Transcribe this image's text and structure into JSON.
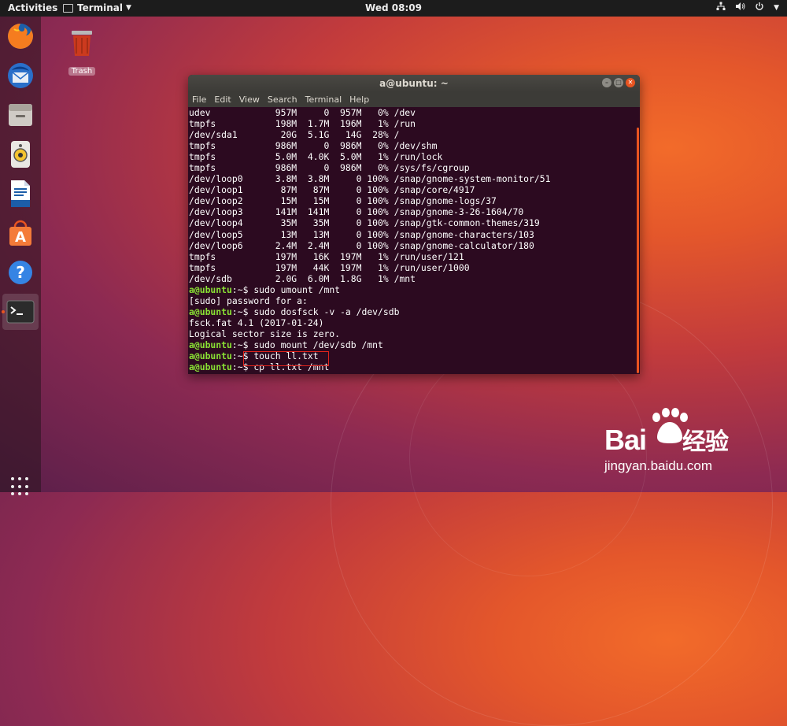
{
  "topbar": {
    "activities": "Activities",
    "app_menu": "Terminal",
    "clock": "Wed 08:09"
  },
  "dock": {
    "items": [
      {
        "name": "firefox-icon"
      },
      {
        "name": "thunderbird-icon"
      },
      {
        "name": "files-icon"
      },
      {
        "name": "rhythmbox-icon"
      },
      {
        "name": "libreoffice-writer-icon"
      },
      {
        "name": "ubuntu-software-icon"
      },
      {
        "name": "help-icon"
      },
      {
        "name": "terminal-icon"
      }
    ]
  },
  "desktop": {
    "trash_label": "Trash"
  },
  "terminal": {
    "title": "a@ubuntu: ~",
    "menu": [
      "File",
      "Edit",
      "View",
      "Search",
      "Terminal",
      "Help"
    ],
    "output_lines": [
      "udev            957M     0  957M   0% /dev",
      "tmpfs           198M  1.7M  196M   1% /run",
      "/dev/sda1        20G  5.1G   14G  28% /",
      "tmpfs           986M     0  986M   0% /dev/shm",
      "tmpfs           5.0M  4.0K  5.0M   1% /run/lock",
      "tmpfs           986M     0  986M   0% /sys/fs/cgroup",
      "/dev/loop0      3.8M  3.8M     0 100% /snap/gnome-system-monitor/51",
      "/dev/loop1       87M   87M     0 100% /snap/core/4917",
      "/dev/loop2       15M   15M     0 100% /snap/gnome-logs/37",
      "/dev/loop3      141M  141M     0 100% /snap/gnome-3-26-1604/70",
      "/dev/loop4       35M   35M     0 100% /snap/gtk-common-themes/319",
      "/dev/loop5       13M   13M     0 100% /snap/gnome-characters/103",
      "/dev/loop6      2.4M  2.4M     0 100% /snap/gnome-calculator/180",
      "tmpfs           197M   16K  197M   1% /run/user/121",
      "tmpfs           197M   44K  197M   1% /run/user/1000",
      "/dev/sdb        2.0G  6.0M  1.8G   1% /mnt"
    ],
    "session": [
      {
        "prompt": "a@ubuntu",
        "path": ":~$ ",
        "text": "sudo umount /mnt"
      },
      {
        "text": "[sudo] password for a:"
      },
      {
        "prompt": "a@ubuntu",
        "path": ":~$ ",
        "text": "sudo dosfsck -v -a /dev/sdb"
      },
      {
        "text": "fsck.fat 4.1 (2017-01-24)"
      },
      {
        "text": "Logical sector size is zero."
      },
      {
        "prompt": "a@ubuntu",
        "path": ":~$ ",
        "text": "sudo mount /dev/sdb /mnt"
      },
      {
        "prompt": "a@ubuntu",
        "path": ":~$ ",
        "text": "touch ll.txt"
      },
      {
        "prompt": "a@ubuntu",
        "path": ":~$ ",
        "text": "cp ll.txt /mnt"
      }
    ]
  },
  "watermark": {
    "brand": "Bai",
    "brand_suffix": "经验",
    "url": "jingyan.baidu.com"
  },
  "colors": {
    "accent": "#e95420",
    "prompt": "#8ae234",
    "terminal_bg": "#2c0a20",
    "highlight_box": "#e0241c"
  }
}
